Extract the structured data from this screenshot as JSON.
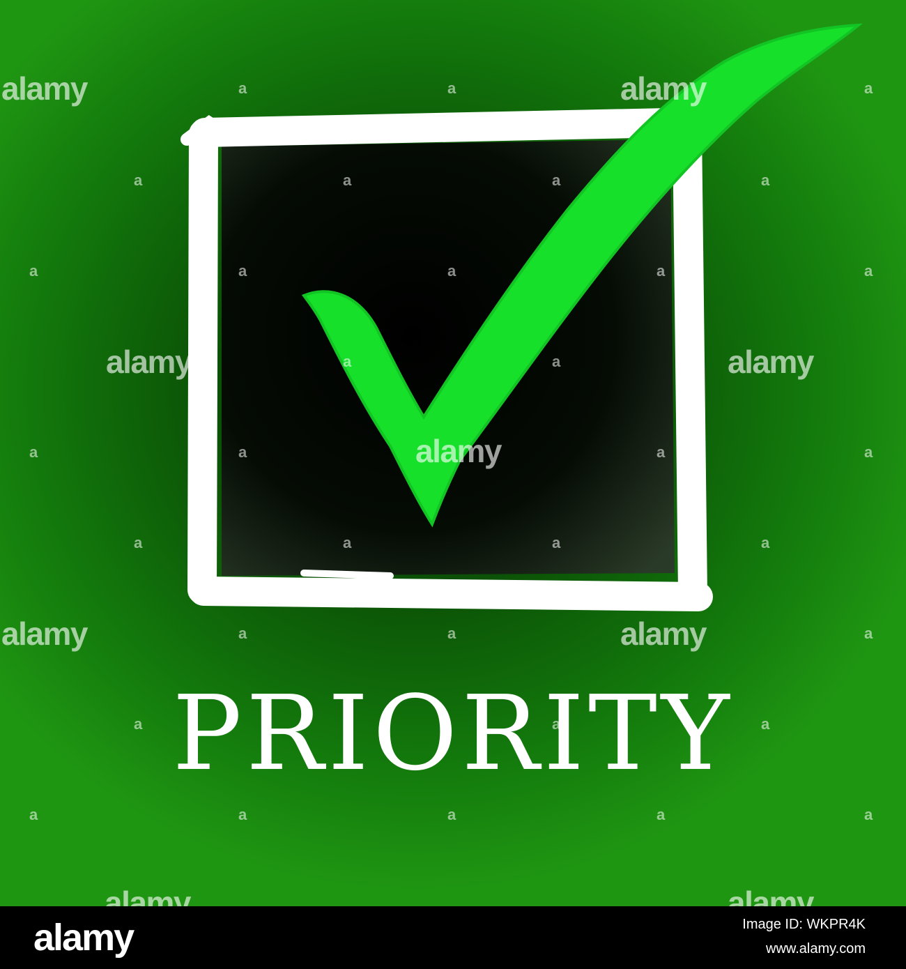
{
  "image": {
    "main_word": "PRIORITY",
    "colors": {
      "check_green": "#16e02a",
      "box_outline": "#ffffff",
      "box_fill": "#0d1a0b",
      "background_green": "#137a0c"
    }
  },
  "icons": {
    "check": "checkmark-icon",
    "box": "checkbox-square-icon"
  },
  "watermark": {
    "logo_text": "alamy",
    "mark": "a"
  },
  "footer": {
    "logo": "alamy",
    "image_id": "Image ID: WKPR4K",
    "url": "www.alamy.com"
  }
}
